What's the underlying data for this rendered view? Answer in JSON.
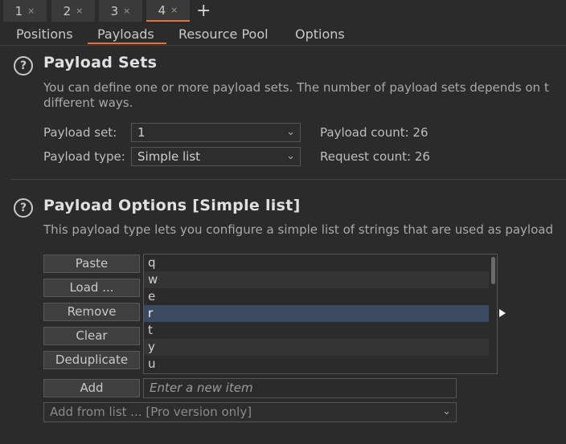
{
  "top_tabs": [
    {
      "label": "1",
      "close": "×"
    },
    {
      "label": "2",
      "close": "×"
    },
    {
      "label": "3",
      "close": "×"
    },
    {
      "label": "4",
      "close": "×"
    }
  ],
  "top_tabs_add": "+",
  "sub_tabs": [
    "Positions",
    "Payloads",
    "Resource Pool",
    "Options"
  ],
  "active_sub_tab": "Payloads",
  "payload_sets": {
    "help": "?",
    "title": "Payload Sets",
    "desc_line1": "You can define one or more payload sets. The number of payload sets depends on t",
    "desc_line2": "different ways.",
    "set_label": "Payload set:",
    "set_value": "1",
    "type_label": "Payload type:",
    "type_value": "Simple list",
    "payload_count": "Payload count:  26",
    "request_count": "Request count: 26"
  },
  "payload_options": {
    "help": "?",
    "title": "Payload Options [Simple list]",
    "desc": "This payload type lets you configure a simple list of strings that are used as payload",
    "buttons": {
      "paste": "Paste",
      "load": "Load ...",
      "remove": "Remove",
      "clear": "Clear",
      "dedup": "Deduplicate",
      "add": "Add"
    },
    "items": [
      "q",
      "w",
      "e",
      "r",
      "t",
      "y",
      "u"
    ],
    "selected_item": "r",
    "add_placeholder": "Enter a new item",
    "add_from_list": "Add from list ... [Pro version only]"
  },
  "colors": {
    "accent": "#e8733a",
    "background": "#2b2b2b",
    "selection": "#3c4a61"
  },
  "icons": {
    "chevron": "chevron-down-icon",
    "help": "help-icon",
    "expand": "expand-arrow-icon"
  }
}
